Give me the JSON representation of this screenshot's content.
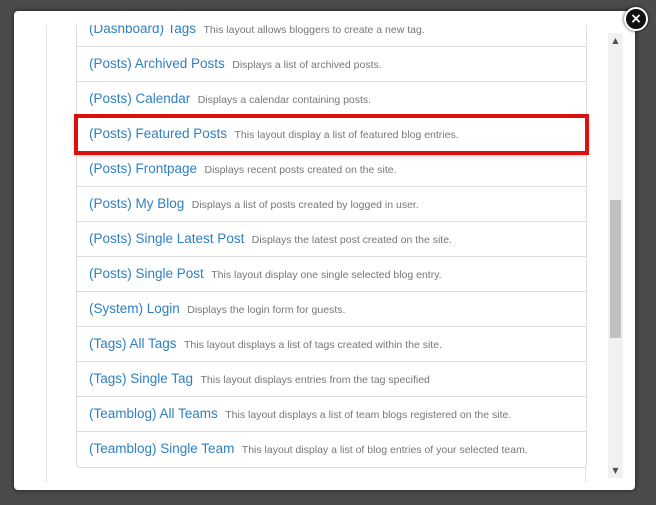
{
  "dialog": {
    "close_label": "×",
    "scroll_up": "▲",
    "scroll_down": "▼",
    "scroll_position": 0.55
  },
  "layouts": [
    {
      "title": "(Dashboard) Tags",
      "desc": "This layout allows bloggers to create a new tag."
    },
    {
      "title": "(Posts) Archived Posts",
      "desc": "Displays a list of archived posts."
    },
    {
      "title": "(Posts) Calendar",
      "desc": "Displays a calendar containing posts."
    },
    {
      "title": "(Posts) Featured Posts",
      "desc": "This layout display a list of featured blog entries."
    },
    {
      "title": "(Posts) Frontpage",
      "desc": "Displays recent posts created on the site."
    },
    {
      "title": "(Posts) My Blog",
      "desc": "Displays a list of posts created by logged in user."
    },
    {
      "title": "(Posts) Single Latest Post",
      "desc": "Displays the latest post created on the site."
    },
    {
      "title": "(Posts) Single Post",
      "desc": "This layout display one single selected blog entry."
    },
    {
      "title": "(System) Login",
      "desc": "Displays the login form for guests."
    },
    {
      "title": "(Tags) All Tags",
      "desc": "This layout displays a list of tags created within the site."
    },
    {
      "title": "(Tags) Single Tag",
      "desc": "This layout displays entries from the tag specified"
    },
    {
      "title": "(Teamblog) All Teams",
      "desc": "This layout displays a list of team blogs registered on the site."
    },
    {
      "title": "(Teamblog) Single Team",
      "desc": "This layout display a list of blog entries of your selected team."
    }
  ],
  "colors": {
    "link": "#2f7fc1",
    "description": "#777777",
    "highlight": "#d9120f"
  }
}
